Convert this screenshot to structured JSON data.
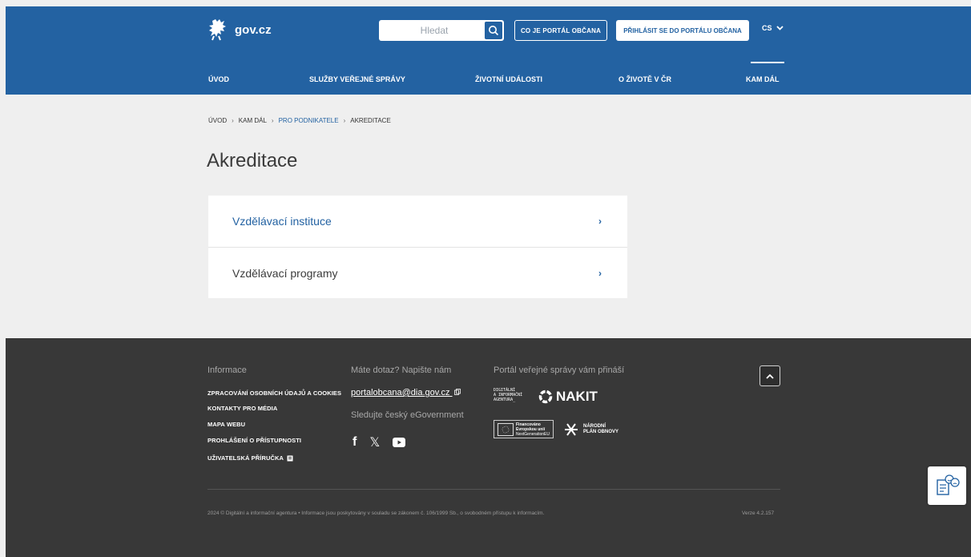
{
  "header": {
    "brand": "gov.cz",
    "search_placeholder": "Hledat",
    "btn_about": "CO JE PORTÁL OBČANA",
    "btn_login": "PŘIHLÁSIT SE DO PORTÁLU OBČANA",
    "lang": "CS",
    "colors": {
      "primary": "#2362a2"
    }
  },
  "nav": [
    {
      "label": "ÚVOD"
    },
    {
      "label": "SLUŽBY VEŘEJNÉ SPRÁVY"
    },
    {
      "label": "ŽIVOTNÍ UDÁLOSTI"
    },
    {
      "label": "O ŽIVOTĚ V ČR"
    },
    {
      "label": "KAM DÁL",
      "active": true
    }
  ],
  "breadcrumb": [
    "ÚVOD",
    "KAM DÁL",
    "PRO PODNIKATELE",
    "AKREDITACE"
  ],
  "page_title": "Akreditace",
  "list": [
    {
      "label": "Vzdělávací instituce"
    },
    {
      "label": "Vzdělávací programy"
    }
  ],
  "footer": {
    "info_heading": "Informace",
    "info_links": [
      "ZPRACOVÁNÍ OSOBNÍCH ÚDAJŮ A COOKIES",
      "KONTAKTY PRO MÉDIA",
      "MAPA WEBU",
      "PROHLÁŠENÍ O PŘÍSTUPNOSTI",
      "UŽIVATELSKÁ PŘÍRUČKA"
    ],
    "question_heading": "Máte dotaz? Napište nám",
    "email": "portalobcana@dia.gov.cz",
    "follow_heading": "Sledujte český eGovernment",
    "portal_heading": "Portál veřejné správy vám přináší",
    "dia_logo_text": [
      "DIGITÁLNÍ",
      "A INFORMAČNÍ",
      "AGENTURA_"
    ],
    "nakit_logo": "NAKIT",
    "eu_logo_text": [
      "Financováno",
      "Evropskou unií",
      "NextGenerationEU"
    ],
    "npo_logo_text": [
      "NÁRODNÍ",
      "PLÁN OBNOVY"
    ],
    "copyright": "2024 © Digitální a informační agentura • Informace jsou poskytovány v souladu se zákonem č. 106/1999 Sb., o svobodném přístupu k informacím.",
    "version": "Verze 4.2.157"
  }
}
